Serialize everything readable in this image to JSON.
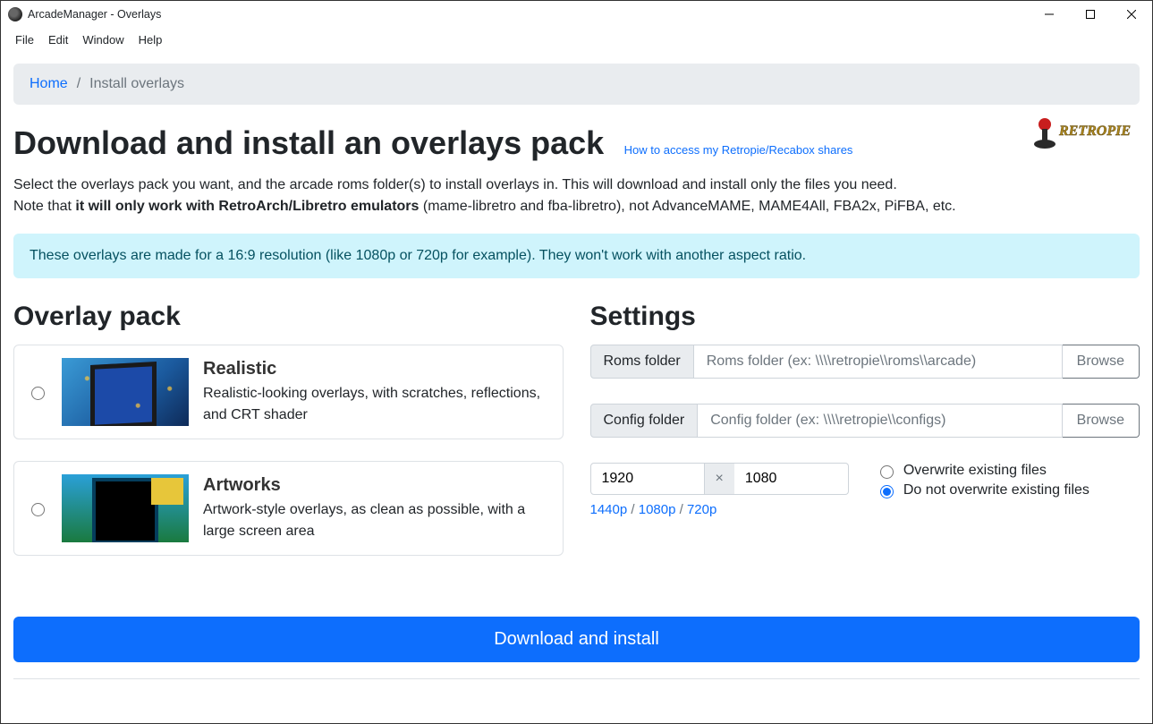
{
  "window": {
    "title": "ArcadeManager - Overlays"
  },
  "menu": {
    "file": "File",
    "edit": "Edit",
    "window": "Window",
    "help": "Help"
  },
  "breadcrumb": {
    "home": "Home",
    "current": "Install overlays"
  },
  "page": {
    "title": "Download and install an overlays pack",
    "help_link": "How to access my Retropie/Recabox shares",
    "intro_line1": "Select the overlays pack you want, and the arcade roms folder(s) to install overlays in. This will download and install only the files you need.",
    "intro_line2_prefix": "Note that ",
    "intro_line2_bold": "it will only work with RetroArch/Libretro emulators",
    "intro_line2_suffix": " (mame-libretro and fba-libretro), not AdvanceMAME, MAME4All, FBA2x, PiFBA, etc.",
    "alert": "These overlays are made for a 16:9 resolution (like 1080p or 720p for example). They won't work with another aspect ratio."
  },
  "logo_text": "RETROPIE",
  "overlay_pack": {
    "heading": "Overlay pack",
    "packs": [
      {
        "title": "Realistic",
        "desc": "Realistic-looking overlays, with scratches, reflections, and CRT shader"
      },
      {
        "title": "Artworks",
        "desc": "Artwork-style overlays, as clean as possible, with a large screen area"
      }
    ]
  },
  "settings": {
    "heading": "Settings",
    "roms_label": "Roms folder",
    "roms_placeholder": "Roms folder (ex: \\\\\\\\retropie\\\\roms\\\\arcade)",
    "config_label": "Config folder",
    "config_placeholder": "Config folder (ex: \\\\\\\\retropie\\\\configs)",
    "browse": "Browse",
    "res_w": "1920",
    "res_h": "1080",
    "res_x": "×",
    "presets": {
      "p1440": "1440p",
      "p1080": "1080p",
      "p720": "720p",
      "sep": " / "
    },
    "overwrite_on": "Overwrite existing files",
    "overwrite_off": "Do not overwrite existing files"
  },
  "action": {
    "download": "Download and install"
  }
}
